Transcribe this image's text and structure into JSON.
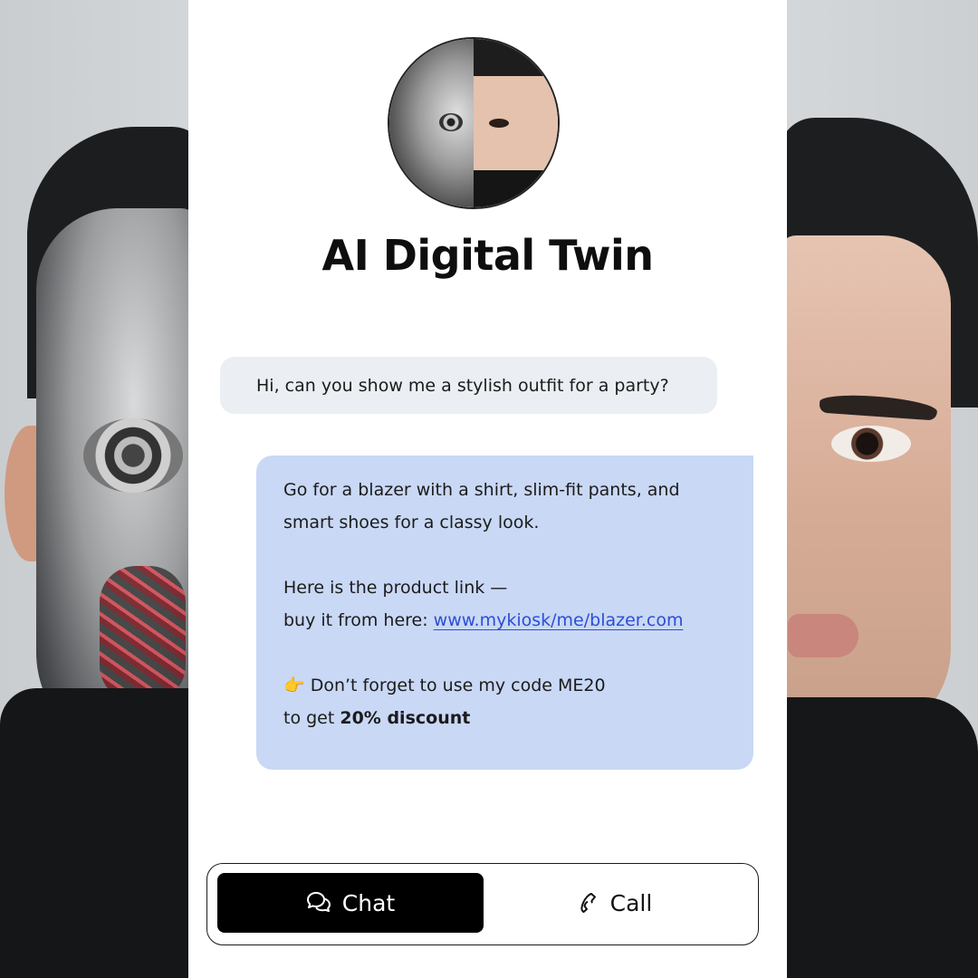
{
  "header": {
    "title": "AI Digital Twin"
  },
  "conversation": {
    "user_message": "Hi, can you show me a stylish outfit for a party?",
    "ai_message": {
      "line1": "Go for a blazer with a shirt, slim-fit pants, and",
      "line2": "smart shoes for a classy look.",
      "line3": "Here is the product link —",
      "line4_prefix": "buy it from here: ",
      "link": "www.mykiosk/me/blazer.com",
      "line5": "👉 Don’t forget to use my code ME20",
      "line6_prefix": "to get ",
      "line6_bold": "20% discount"
    }
  },
  "toggle": {
    "chat_label": "Chat",
    "call_label": "Call",
    "active": "Chat"
  },
  "icons": {
    "chat": "chat-bubbles-icon",
    "call": "phone-icon"
  },
  "colors": {
    "user_bubble": "#ebeef2",
    "ai_bubble": "#c9d8f5",
    "link": "#2a4fd6",
    "active_button": "#000000"
  }
}
